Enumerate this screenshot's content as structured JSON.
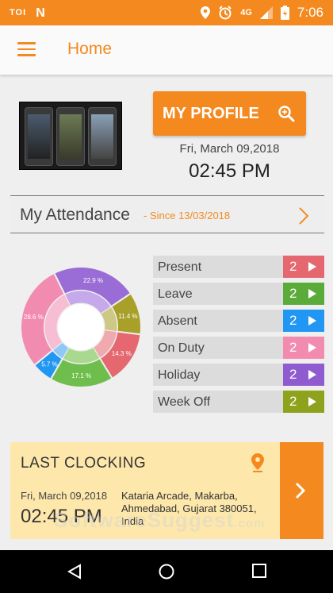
{
  "status_bar": {
    "carrier": "TOI",
    "network": "4G",
    "time": "7:06"
  },
  "app_bar": {
    "title": "Home"
  },
  "profile": {
    "button_label": "MY PROFILE",
    "date": "Fri, March 09,2018",
    "time": "02:45 PM"
  },
  "attendance": {
    "title": "My Attendance",
    "since": "- Since 13/03/2018",
    "items": [
      {
        "label": "Present",
        "count": "2",
        "color": "#e5676f"
      },
      {
        "label": "Leave",
        "count": "2",
        "color": "#5bab3a"
      },
      {
        "label": "Absent",
        "count": "2",
        "color": "#2196f3"
      },
      {
        "label": "On Duty",
        "count": "2",
        "color": "#f28bb0"
      },
      {
        "label": "Holiday",
        "count": "2",
        "color": "#8f5ccf"
      },
      {
        "label": "Week Off",
        "count": "2",
        "color": "#8ea21c"
      }
    ]
  },
  "chart_data": {
    "type": "pie",
    "labels": [
      "Present",
      "Leave",
      "Absent",
      "On Duty",
      "Holiday",
      "Week Off"
    ],
    "values": [
      14.3,
      17.1,
      5.7,
      28.6,
      22.9,
      11.4
    ],
    "value_labels": [
      "14.3 %",
      "17.1 %",
      "5.7 %",
      "28.6 %",
      "22.9 %",
      "11.4 %"
    ],
    "colors": [
      "#e5676f",
      "#6fbe4d",
      "#2196f3",
      "#f28bb0",
      "#9a6dd6",
      "#a9a02a"
    ],
    "inner_colors": [
      "#f0a9ae",
      "#a9d98f",
      "#8ec8f7",
      "#f7bdd2",
      "#c6a9ea",
      "#cdc886"
    ]
  },
  "last_clocking": {
    "title": "LAST CLOCKING",
    "date": "Fri, March 09,2018",
    "time": "02:45 PM",
    "address": "Kataria Arcade, Makarba, Ahmedabad, Gujarat 380051, India"
  },
  "watermark": {
    "main": "SoftwareSuggest",
    "suffix": ".com"
  }
}
